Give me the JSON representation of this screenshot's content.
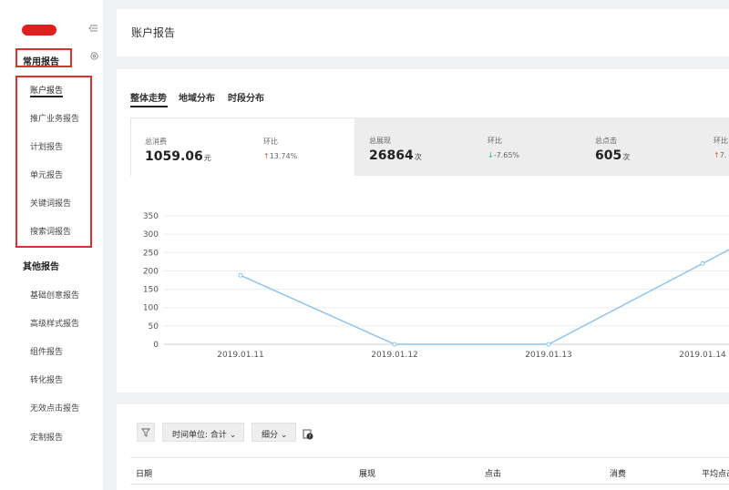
{
  "sidebar": {
    "common_title": "常用报告",
    "common_items": [
      "账户报告",
      "推广业务报告",
      "计划报告",
      "单元报告",
      "关键词报告",
      "搜索词报告"
    ],
    "other_title": "其他报告",
    "other_items": [
      "基础创意报告",
      "高级样式报告",
      "组件报告",
      "转化报告",
      "无效点击报告",
      "定制报告"
    ]
  },
  "header": {
    "title": "账户报告"
  },
  "tabs": [
    "整体走势",
    "地域分布",
    "时段分布"
  ],
  "metrics": [
    {
      "label": "总消费",
      "value": "1059.06",
      "unit": "元",
      "change_label": "环比",
      "change": "13.74%",
      "direction": "up"
    },
    {
      "label": "总展现",
      "value": "26864",
      "unit": "次",
      "change_label": "环比",
      "change": "-7.65%",
      "direction": "down"
    },
    {
      "label": "总点击",
      "value": "605",
      "unit": "次",
      "change_label": "环比",
      "change": "7.",
      "direction": "up"
    }
  ],
  "chart_data": {
    "type": "line",
    "categories": [
      "2019.01.11",
      "2019.01.12",
      "2019.01.13",
      "2019.01.14"
    ],
    "series": [
      {
        "values": [
          188,
          0,
          0,
          220
        ]
      }
    ],
    "ylim": [
      0,
      350
    ],
    "yticks": [
      0,
      50,
      100,
      150,
      200,
      250,
      300,
      350
    ],
    "grid": true,
    "line_color": "#8cc4ef"
  },
  "toolbar": {
    "time_unit": "时间单位: 合计",
    "breakdown": "细分"
  },
  "table": {
    "headers": [
      "日期",
      "展现",
      "点击",
      "消费",
      "平均点击"
    ]
  },
  "colors": {
    "highlight": "#d93030",
    "up": "#e05a4a",
    "down": "#2eb37a"
  }
}
